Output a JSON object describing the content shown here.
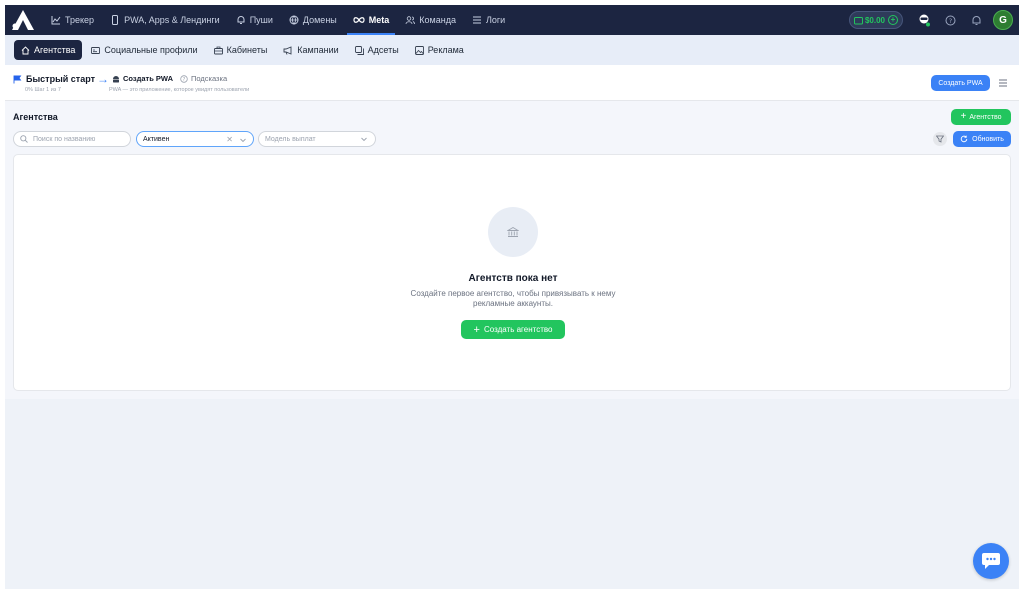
{
  "topnav": {
    "items": [
      {
        "label": "Трекер",
        "icon": "chart-line-icon"
      },
      {
        "label": "PWA, Apps & Лендинги",
        "icon": "phone-icon"
      },
      {
        "label": "Пуши",
        "icon": "bell-icon"
      },
      {
        "label": "Домены",
        "icon": "globe-icon"
      },
      {
        "label": "Meta",
        "icon": "infinity-icon",
        "active": true
      },
      {
        "label": "Команда",
        "icon": "users-icon"
      },
      {
        "label": "Логи",
        "icon": "list-icon"
      }
    ],
    "balance": "$0.00",
    "avatar_letter": "G"
  },
  "subnav": {
    "items": [
      {
        "label": "Агентства",
        "icon": "home-icon",
        "active": true
      },
      {
        "label": "Социальные профили",
        "icon": "id-card-icon"
      },
      {
        "label": "Кабинеты",
        "icon": "briefcase-icon"
      },
      {
        "label": "Кампании",
        "icon": "megaphone-icon"
      },
      {
        "label": "Адсеты",
        "icon": "layers-icon"
      },
      {
        "label": "Реклама",
        "icon": "image-icon"
      }
    ]
  },
  "quickstart": {
    "title": "Быстрый старт",
    "step_label": "Создать PWA",
    "hint_label": "Подсказка",
    "progress": "0%  Шаг 1 из 7",
    "description": "PWA — это приложение, которое увидят пользователи",
    "create_button": "Создать PWA"
  },
  "section": {
    "title": "Агентства",
    "add_button": "Агентство",
    "search_placeholder": "Поиск по названию",
    "status_value": "Активен",
    "payout_placeholder": "Модель выплат",
    "refresh_button": "Обновить"
  },
  "empty": {
    "title": "Агентств пока нет",
    "description": "Создайте первое агентство, чтобы привязывать к нему рекламные аккаунты.",
    "button": "Создать агентство"
  },
  "colors": {
    "nav_bg": "#1c2541",
    "accent_blue": "#3b82f6",
    "accent_green": "#22c55e"
  }
}
